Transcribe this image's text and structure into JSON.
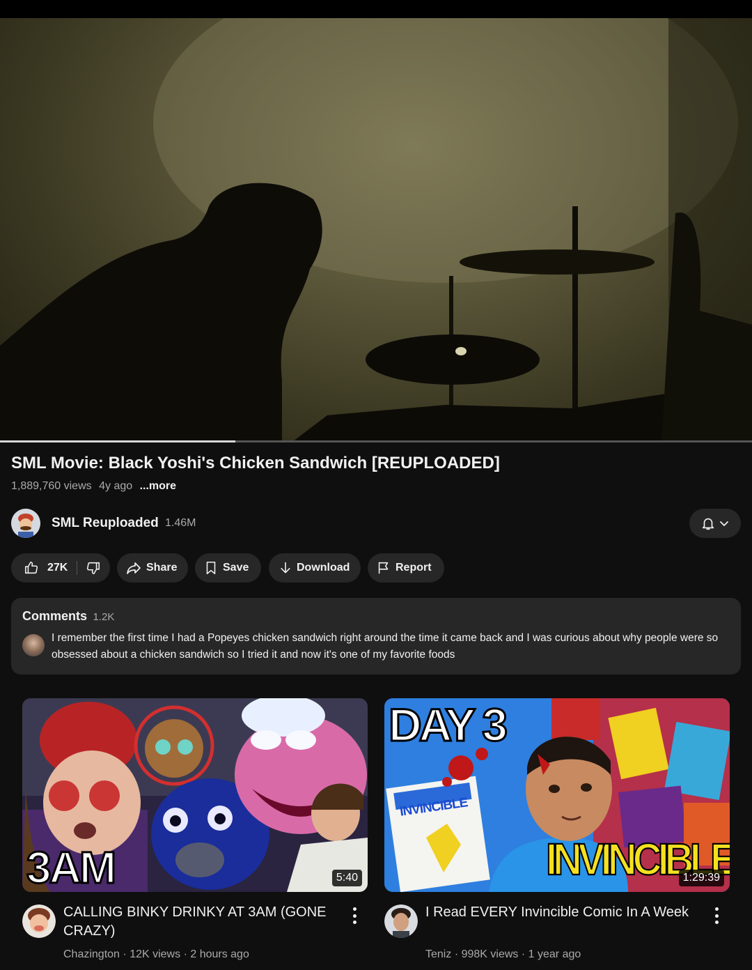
{
  "video": {
    "title": "SML Movie: Black Yoshi's Chicken Sandwich [REUPLOADED]",
    "views": "1,889,760 views",
    "age": "4y ago",
    "more_label": "...more",
    "progress_fraction": 0.313
  },
  "channel": {
    "name": "SML Reuploaded",
    "subscribers": "1.46M",
    "bell_icon": "bell-icon",
    "chevron_icon": "chevron-down-icon"
  },
  "actions": {
    "like_count": "27K",
    "share_label": "Share",
    "save_label": "Save",
    "download_label": "Download",
    "report_label": "Report"
  },
  "comments": {
    "label": "Comments",
    "count": "1.2K",
    "top_comment": "I remember the first time I had a Popeyes chicken sandwich right around the time it came back and I was curious about why people were so obsessed about a chicken sandwich so I tried it and now it's one of my favorite foods"
  },
  "recommendations": [
    {
      "title": "CALLING BINKY DRINKY AT 3AM (GONE CRAZY)",
      "channel": "Chazington",
      "views": "12K views",
      "age": "2 hours ago",
      "duration": "5:40",
      "thumb_text": "3AM"
    },
    {
      "title": "I Read EVERY Invincible Comic In A Week",
      "channel": "Teniz",
      "views": "998K views",
      "age": "1 year ago",
      "duration": "1:29:39",
      "thumb_text_top": "DAY 3",
      "thumb_text_bottom": "INVINCIBLE",
      "thumb_text_comic": "INVINCIBLE"
    }
  ],
  "colors": {
    "background": "#0f0f0f",
    "surface": "#272727",
    "text_primary": "#f1f1f1",
    "text_secondary": "#aaaaaa"
  }
}
